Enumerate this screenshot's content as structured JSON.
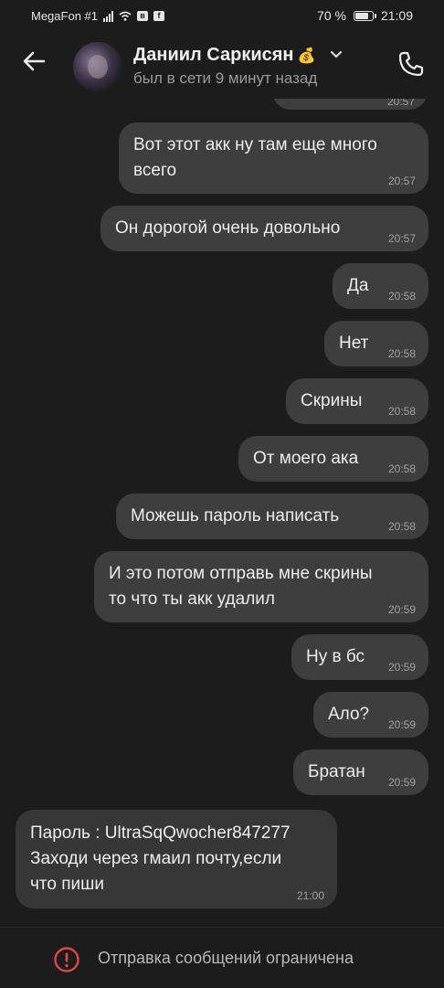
{
  "status_bar": {
    "carrier": "MegaFon #1",
    "battery": "70 %",
    "battery_level": 0.7,
    "time": "21:09",
    "icons": [
      "signal-icon",
      "wifi-icon",
      "vk-icon",
      "facebook-icon",
      "battery-icon"
    ]
  },
  "header": {
    "name": "Даниил Саркисян",
    "name_emoji": "💰",
    "status": "был в сети 9 минут назад"
  },
  "messages": [
    {
      "side": "out",
      "text": "",
      "time": "20:57",
      "partial": true
    },
    {
      "side": "out",
      "text": "Вот этот акк ну там еще много\nвсего",
      "time": "20:57"
    },
    {
      "side": "out",
      "text": "Он дорогой очень довольно",
      "time": "20:57"
    },
    {
      "side": "out",
      "text": "Да",
      "time": "20:58"
    },
    {
      "side": "out",
      "text": "Нет",
      "time": "20:58"
    },
    {
      "side": "out",
      "text": "Скрины",
      "time": "20:58"
    },
    {
      "side": "out",
      "text": "От моего ака",
      "time": "20:58"
    },
    {
      "side": "out",
      "text": "Можешь пароль написать",
      "time": "20:58"
    },
    {
      "side": "out",
      "text": "И это потом отправь мне скрины\nто что ты акк удалил",
      "time": "20:59"
    },
    {
      "side": "out",
      "text": "Ну в бс",
      "time": "20:59"
    },
    {
      "side": "out",
      "text": "Ало?",
      "time": "20:59"
    },
    {
      "side": "out",
      "text": "Братан",
      "time": "20:59"
    },
    {
      "side": "in",
      "text": "Пароль : UltraSqQwocher847277\nЗаходи через гмаил почту,если\nчто пиши",
      "time": "21:00"
    }
  ],
  "footer": {
    "restricted_text": "Отправка сообщений ограничена"
  }
}
